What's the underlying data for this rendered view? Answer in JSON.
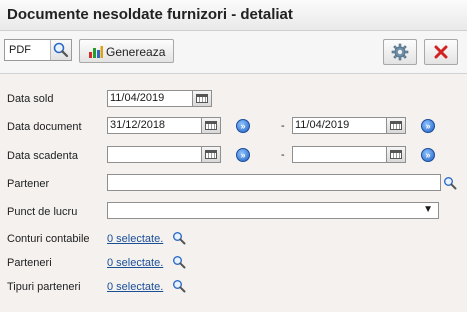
{
  "window": {
    "title": "Documente nesoldate furnizori - detaliat"
  },
  "toolbar": {
    "format_value": "PDF",
    "generate_label": "Genereaza",
    "icons": {
      "format_search": "magnifier-icon",
      "generate": "bar-chart-icon",
      "settings": "gear-icon",
      "close": "close-icon"
    },
    "close_color": "#d12222"
  },
  "form": {
    "data_sold": {
      "label": "Data sold",
      "value": "11/04/2019"
    },
    "data_document": {
      "label": "Data document",
      "from": "31/12/2018",
      "separator": "-",
      "to": "11/04/2019"
    },
    "data_scadenta": {
      "label": "Data scadenta",
      "from": "",
      "separator": "-",
      "to": ""
    },
    "partener": {
      "label": "Partener",
      "value": ""
    },
    "punct_de_lucru": {
      "label": "Punct de lucru",
      "value": ""
    },
    "conturi_contabile": {
      "label": "Conturi contabile",
      "link": "0 selectate."
    },
    "parteneri": {
      "label": "Parteneri",
      "link": "0 selectate."
    },
    "tipuri_parteneri": {
      "label": "Tipuri parteneri",
      "link": "0 selectate."
    }
  },
  "colors": {
    "link": "#1b4f96",
    "accent_button": "#1f5fc4"
  }
}
